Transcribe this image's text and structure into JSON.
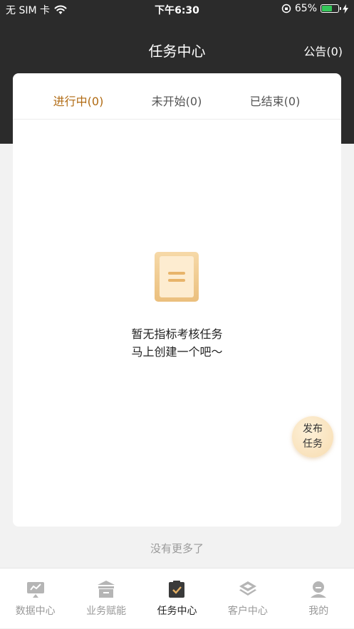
{
  "status_bar": {
    "carrier": "无 SIM 卡",
    "time": "下午6:30",
    "battery_percent": "65%",
    "battery_level": 0.65
  },
  "header": {
    "title": "任务中心",
    "notice_label": "公告(0)"
  },
  "tabs": [
    {
      "label": "进行中(0)",
      "active": true
    },
    {
      "label": "未开始(0)",
      "active": false
    },
    {
      "label": "已结束(0)",
      "active": false
    }
  ],
  "empty_state": {
    "line1": "暂无指标考核任务",
    "line2": "马上创建一个吧～",
    "icon": "document-icon"
  },
  "fab": {
    "line1": "发布",
    "line2": "任务"
  },
  "footer_text": "没有更多了",
  "tab_bar": {
    "items": [
      {
        "label": "数据中心",
        "icon": "chart-monitor-icon",
        "active": false
      },
      {
        "label": "业务赋能",
        "icon": "box-icon",
        "active": false
      },
      {
        "label": "任务中心",
        "icon": "clipboard-check-icon",
        "active": true
      },
      {
        "label": "客户中心",
        "icon": "layers-icon",
        "active": false
      },
      {
        "label": "我的",
        "icon": "user-icon",
        "active": false
      }
    ]
  },
  "colors": {
    "header_bg": "#2b2b2b",
    "accent": "#b06a12",
    "battery_green": "#34c759",
    "icon_gold": "#ebbf7d"
  }
}
